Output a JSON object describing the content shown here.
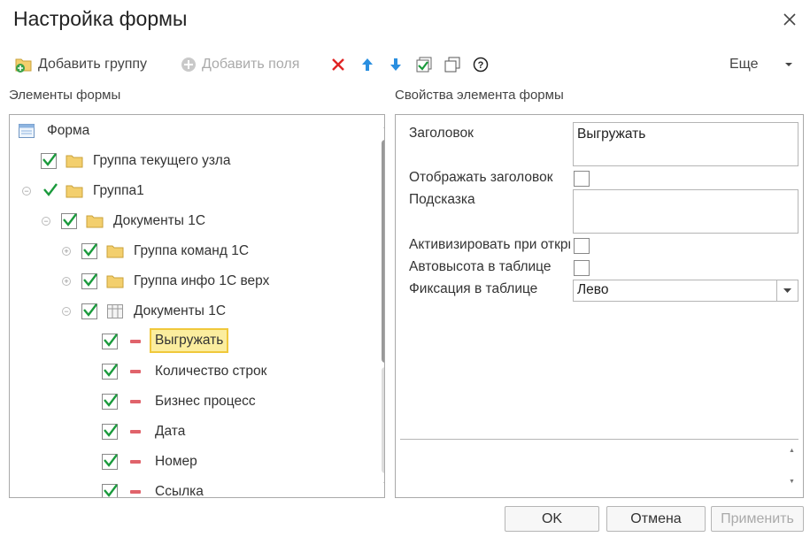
{
  "dialog": {
    "title": "Настройка формы"
  },
  "toolbar": {
    "add_group_label": "Добавить группу",
    "add_fields_label": "Добавить поля",
    "more_label": "Еще",
    "icons": [
      "delete-icon",
      "move-up-icon",
      "move-down-icon",
      "check-all-icon",
      "copy-icon",
      "help-icon"
    ]
  },
  "tree": {
    "header": "Элементы формы",
    "items": [
      {
        "label": "Форма",
        "icon": "form-icon"
      },
      {
        "label": "Группа текущего узла",
        "checked": true,
        "icon": "folder-icon"
      },
      {
        "label": "Группа1",
        "checked": true,
        "icon": "folder-icon",
        "expanded": true
      },
      {
        "label": "Документы 1С",
        "checked": true,
        "icon": "folder-icon",
        "expanded": true
      },
      {
        "label": "Группа команд 1С",
        "checked": true,
        "icon": "folder-icon",
        "expanded": false
      },
      {
        "label": "Группа инфо 1С верх",
        "checked": true,
        "icon": "folder-icon",
        "expanded": false
      },
      {
        "label": "Документы 1С",
        "checked": true,
        "icon": "table-icon",
        "expanded": true
      },
      {
        "label": "Выгружать",
        "checked": true,
        "icon": "field-icon",
        "selected": true
      },
      {
        "label": "Количество строк",
        "checked": true,
        "icon": "field-icon"
      },
      {
        "label": "Бизнес процесс",
        "checked": true,
        "icon": "field-icon"
      },
      {
        "label": "Дата",
        "checked": true,
        "icon": "field-icon"
      },
      {
        "label": "Номер",
        "checked": true,
        "icon": "field-icon"
      },
      {
        "label": "Ссылка",
        "checked": true,
        "icon": "field-icon"
      }
    ]
  },
  "props": {
    "header": "Свойства элемента формы",
    "title_label": "Заголовок",
    "title_value": "Выгружать",
    "show_title_label": "Отображать заголовок",
    "show_title_checked": false,
    "tooltip_label": "Подсказка",
    "tooltip_value": "",
    "activate_label": "Активизировать при открытии",
    "activate_checked": false,
    "autoheight_label": "Автовысота в таблице",
    "autoheight_checked": false,
    "fix_label": "Фиксация в таблице",
    "fix_value": "Лево"
  },
  "buttons": {
    "ok": "OK",
    "cancel": "Отмена",
    "apply": "Применить"
  },
  "colors": {
    "check_green": "#1a9a3c",
    "folder_yellow": "#f3cf6d",
    "field_red": "#e0636b",
    "selection_fill": "#fbed9e",
    "selection_border": "#f0c83b",
    "delete_red": "#e02424",
    "arrow_blue": "#2a8fe0"
  }
}
